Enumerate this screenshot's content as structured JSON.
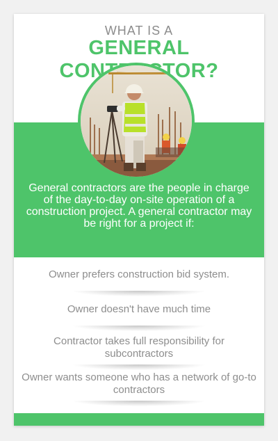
{
  "header": {
    "kicker": "WHAT IS A",
    "title": "GENERAL CONTRACTOR?"
  },
  "photo": {
    "subject": "construction worker surveying on a building site",
    "icon": "construction-photo"
  },
  "intro": {
    "text": "General contractors are the people in charge of the day-to-day on-site operation of a construction project. A general contractor may be right for a project if:"
  },
  "criteria": [
    {
      "text": "Owner prefers construction bid system."
    },
    {
      "text": "Owner doesn't have much time"
    },
    {
      "text": "Contractor takes full responsibility for subcontractors"
    },
    {
      "text": "Owner wants someone who has a network of go-to contractors"
    }
  ],
  "colors": {
    "brand_green": "#4ec46a",
    "text_gray": "#8d8d8d",
    "page_background": "#f1f1f1"
  }
}
